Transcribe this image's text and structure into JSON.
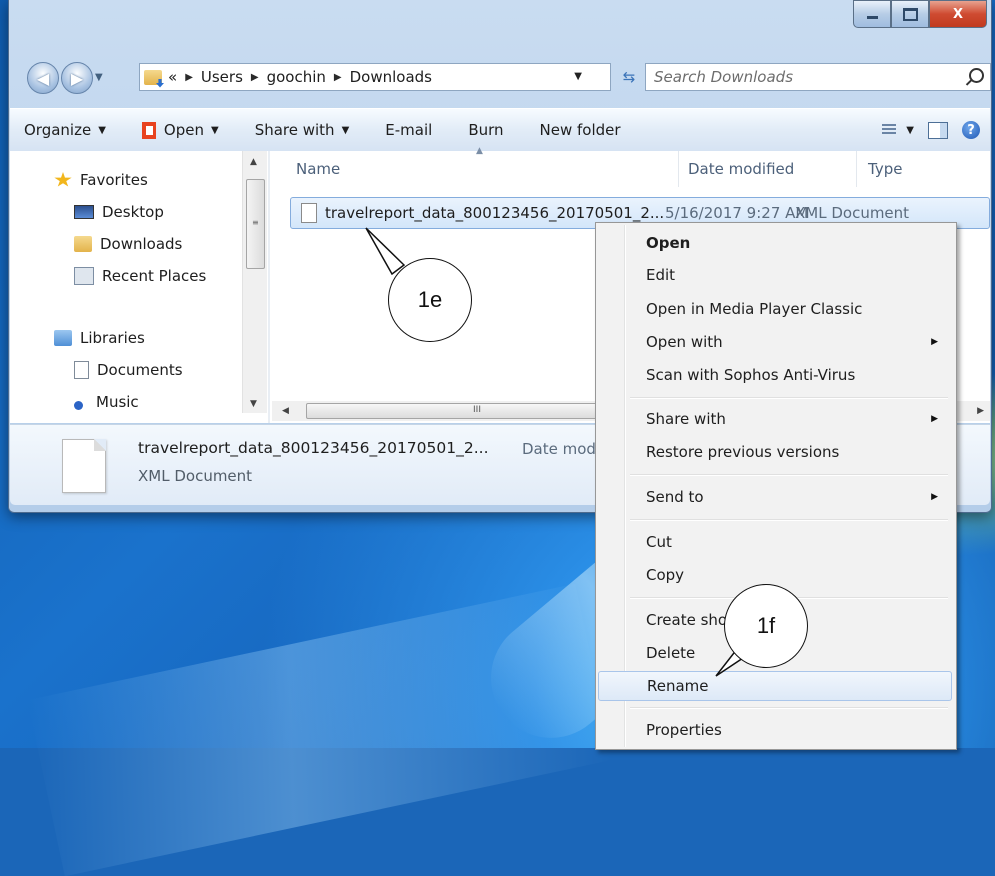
{
  "address": {
    "overflow": "«",
    "crumbs": [
      "Users",
      "goochin",
      "Downloads"
    ]
  },
  "search": {
    "placeholder": "Search Downloads"
  },
  "toolbar": {
    "organize": "Organize",
    "open": "Open",
    "share_with": "Share with",
    "email": "E-mail",
    "burn": "Burn",
    "new_folder": "New folder"
  },
  "nav": {
    "favorites": "Favorites",
    "desktop": "Desktop",
    "downloads": "Downloads",
    "recent_places": "Recent Places",
    "libraries": "Libraries",
    "documents": "Documents",
    "music": "Music"
  },
  "columns": {
    "name": "Name",
    "date_modified": "Date modified",
    "type": "Type"
  },
  "file": {
    "name": "travelreport_data_800123456_20170501_2...",
    "date": "5/16/2017 9:27 AM",
    "type": "XML Document"
  },
  "details": {
    "name": "travelreport_data_800123456_20170501_2...",
    "date_label": "Date mod",
    "type": "XML Document"
  },
  "scrollbar": {
    "grip": "III"
  },
  "context_menu": {
    "items": [
      {
        "label": "Open"
      },
      {
        "label": "Edit"
      },
      {
        "label": "Open in Media Player Classic"
      },
      {
        "label": "Open with"
      },
      {
        "label": "Scan with Sophos Anti-Virus"
      },
      {
        "label": "Share with"
      },
      {
        "label": "Restore previous versions"
      },
      {
        "label": "Send to"
      },
      {
        "label": "Cut"
      },
      {
        "label": "Copy"
      },
      {
        "label": "Create sho"
      },
      {
        "label": "Delete"
      },
      {
        "label": "Rename"
      },
      {
        "label": "Properties"
      }
    ]
  },
  "callouts": {
    "c1e": "1e",
    "c1f": "1f"
  },
  "window_controls": {
    "close": "X"
  }
}
